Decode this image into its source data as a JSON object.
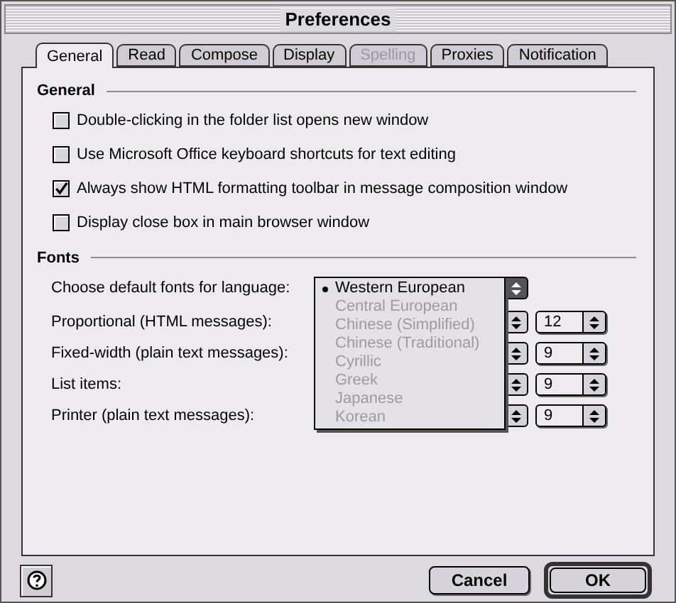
{
  "window": {
    "title": "Preferences"
  },
  "tabs": [
    {
      "label": "General",
      "selected": true,
      "disabled": false
    },
    {
      "label": "Read",
      "selected": false,
      "disabled": false
    },
    {
      "label": "Compose",
      "selected": false,
      "disabled": false
    },
    {
      "label": "Display",
      "selected": false,
      "disabled": false
    },
    {
      "label": "Spelling",
      "selected": false,
      "disabled": true
    },
    {
      "label": "Proxies",
      "selected": false,
      "disabled": false
    },
    {
      "label": "Notification",
      "selected": false,
      "disabled": false
    }
  ],
  "general": {
    "title": "General",
    "options": [
      {
        "label": "Double-clicking in the folder list opens new window",
        "checked": false
      },
      {
        "label": "Use Microsoft Office keyboard shortcuts for text editing",
        "checked": false
      },
      {
        "label": "Always show HTML formatting toolbar in message composition window",
        "checked": true
      },
      {
        "label": "Display close box in main browser window",
        "checked": false
      }
    ]
  },
  "fonts": {
    "title": "Fonts",
    "language_label": "Choose default fonts for language:",
    "language_menu": [
      {
        "label": "Western European",
        "selected": true,
        "disabled": false
      },
      {
        "label": "Central European",
        "selected": false,
        "disabled": true
      },
      {
        "label": "Chinese (Simplified)",
        "selected": false,
        "disabled": true
      },
      {
        "label": "Chinese (Traditional)",
        "selected": false,
        "disabled": true
      },
      {
        "label": "Cyrillic",
        "selected": false,
        "disabled": true
      },
      {
        "label": "Greek",
        "selected": false,
        "disabled": true
      },
      {
        "label": "Japanese",
        "selected": false,
        "disabled": true
      },
      {
        "label": "Korean",
        "selected": false,
        "disabled": true
      }
    ],
    "rows": [
      {
        "label": "Proportional (HTML messages):",
        "size": "12"
      },
      {
        "label": "Fixed-width (plain text messages):",
        "size": "9"
      },
      {
        "label": "List items:",
        "size": "9"
      },
      {
        "label": "Printer (plain text messages):",
        "size": "9"
      }
    ]
  },
  "buttons": [
    {
      "label": "Cancel",
      "default": false
    },
    {
      "label": "OK",
      "default": true
    }
  ]
}
